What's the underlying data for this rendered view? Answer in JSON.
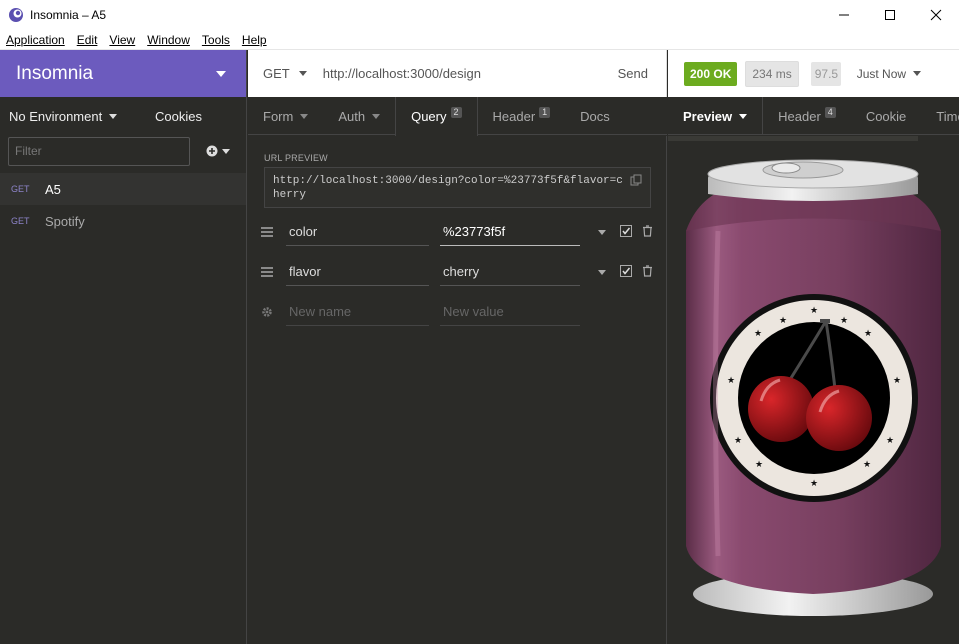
{
  "window": {
    "title": "Insomnia – A5",
    "minimize": "—",
    "maximize": "☐",
    "close": "✕"
  },
  "menu": {
    "items": [
      "Application",
      "Edit",
      "View",
      "Window",
      "Tools",
      "Help"
    ]
  },
  "sidebar": {
    "brand": "Insomnia",
    "environment": "No Environment",
    "cookies": "Cookies",
    "filter_placeholder": "Filter",
    "requests": [
      {
        "method": "GET",
        "name": "A5"
      },
      {
        "method": "GET",
        "name": "Spotify"
      }
    ]
  },
  "request": {
    "method": "GET",
    "url": "http://localhost:3000/design",
    "send": "Send",
    "tabs": [
      {
        "label": "Form",
        "badge": ""
      },
      {
        "label": "Auth",
        "badge": ""
      },
      {
        "label": "Query",
        "badge": "2"
      },
      {
        "label": "Header",
        "badge": "1"
      },
      {
        "label": "Docs",
        "badge": ""
      }
    ],
    "url_preview_label": "URL PREVIEW",
    "url_preview": "http://localhost:3000/design?color=%23773f5f&flavor=cherry",
    "params": [
      {
        "name": "color",
        "value": "%23773f5f"
      },
      {
        "name": "flavor",
        "value": "cherry"
      }
    ],
    "new_name_placeholder": "New name",
    "new_value_placeholder": "New value"
  },
  "response": {
    "status": "200 OK",
    "time": "234 ms",
    "size": "97.5",
    "when": "Just Now",
    "tabs": [
      {
        "label": "Preview",
        "badge": ""
      },
      {
        "label": "Header",
        "badge": "4"
      },
      {
        "label": "Cookie",
        "badge": ""
      },
      {
        "label": "Timeline",
        "badge": ""
      }
    ],
    "can_color": "#773f5f"
  },
  "colors": {
    "brand": "#6c5bbe",
    "status_ok": "#6cab1f",
    "get_method": "#8d84c9"
  }
}
